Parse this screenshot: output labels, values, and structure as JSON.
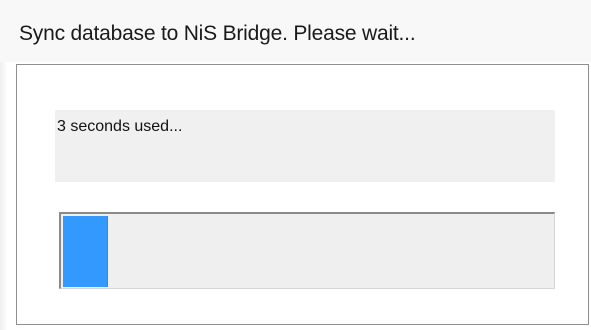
{
  "window": {
    "title": "Sync database to NiS Bridge. Please wait..."
  },
  "status": {
    "text": "3 seconds used..."
  },
  "progress": {
    "fraction": 0.09,
    "fill_color": "#3399ff"
  }
}
